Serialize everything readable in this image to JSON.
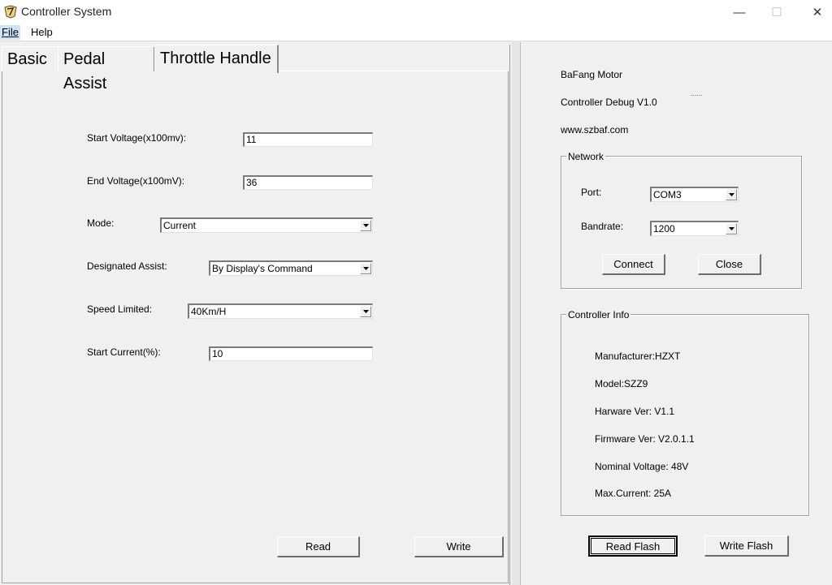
{
  "window": {
    "title": "Controller System",
    "minimize_glyph": "—",
    "maximize_glyph": "☐",
    "close_glyph": "✕"
  },
  "menu": {
    "file": "File",
    "help": "Help"
  },
  "tabs": [
    {
      "label": "Basic"
    },
    {
      "label": "Pedal Assist"
    },
    {
      "label": "Throttle Handle",
      "active": true
    }
  ],
  "throttle": {
    "start_voltage_label": "Start Voltage(x100mv):",
    "start_voltage_value": "11",
    "end_voltage_label": "End Voltage(x100mV):",
    "end_voltage_value": "36",
    "mode_label": "Mode:",
    "mode_value": "Current",
    "designated_assist_label": "Designated Assist:",
    "designated_assist_value": "By Display's Command",
    "speed_limited_label": "Speed Limited:",
    "speed_limited_value": "40Km/H",
    "start_current_label": "Start Current(%):",
    "start_current_value": "10",
    "read_label": "Read",
    "write_label": "Write"
  },
  "info": {
    "brand": "BaFang Motor",
    "product": "Controller Debug V1.0",
    "dots": "......",
    "website": "www.szbaf.com"
  },
  "network": {
    "title": "Network",
    "port_label": "Port:",
    "port_value": "COM3",
    "baud_label": "Bandrate:",
    "baud_value": "1200",
    "connect_label": "Connect",
    "close_label": "Close"
  },
  "controller_info": {
    "title": "Controller Info",
    "manufacturer": "Manufacturer:HZXT",
    "model": "Model:SZZ9",
    "hardware": "Harware Ver: V1.1",
    "firmware": "Firmware Ver: V2.0.1.1",
    "nominal_voltage": "Nominal Voltage: 48V",
    "max_current": "Max.Current: 25A"
  },
  "flash": {
    "read_label": "Read Flash",
    "write_label": "Write Flash"
  },
  "colors": {
    "menu_highlight": "#cce4f7",
    "window_bg": "#f0f0f0"
  }
}
